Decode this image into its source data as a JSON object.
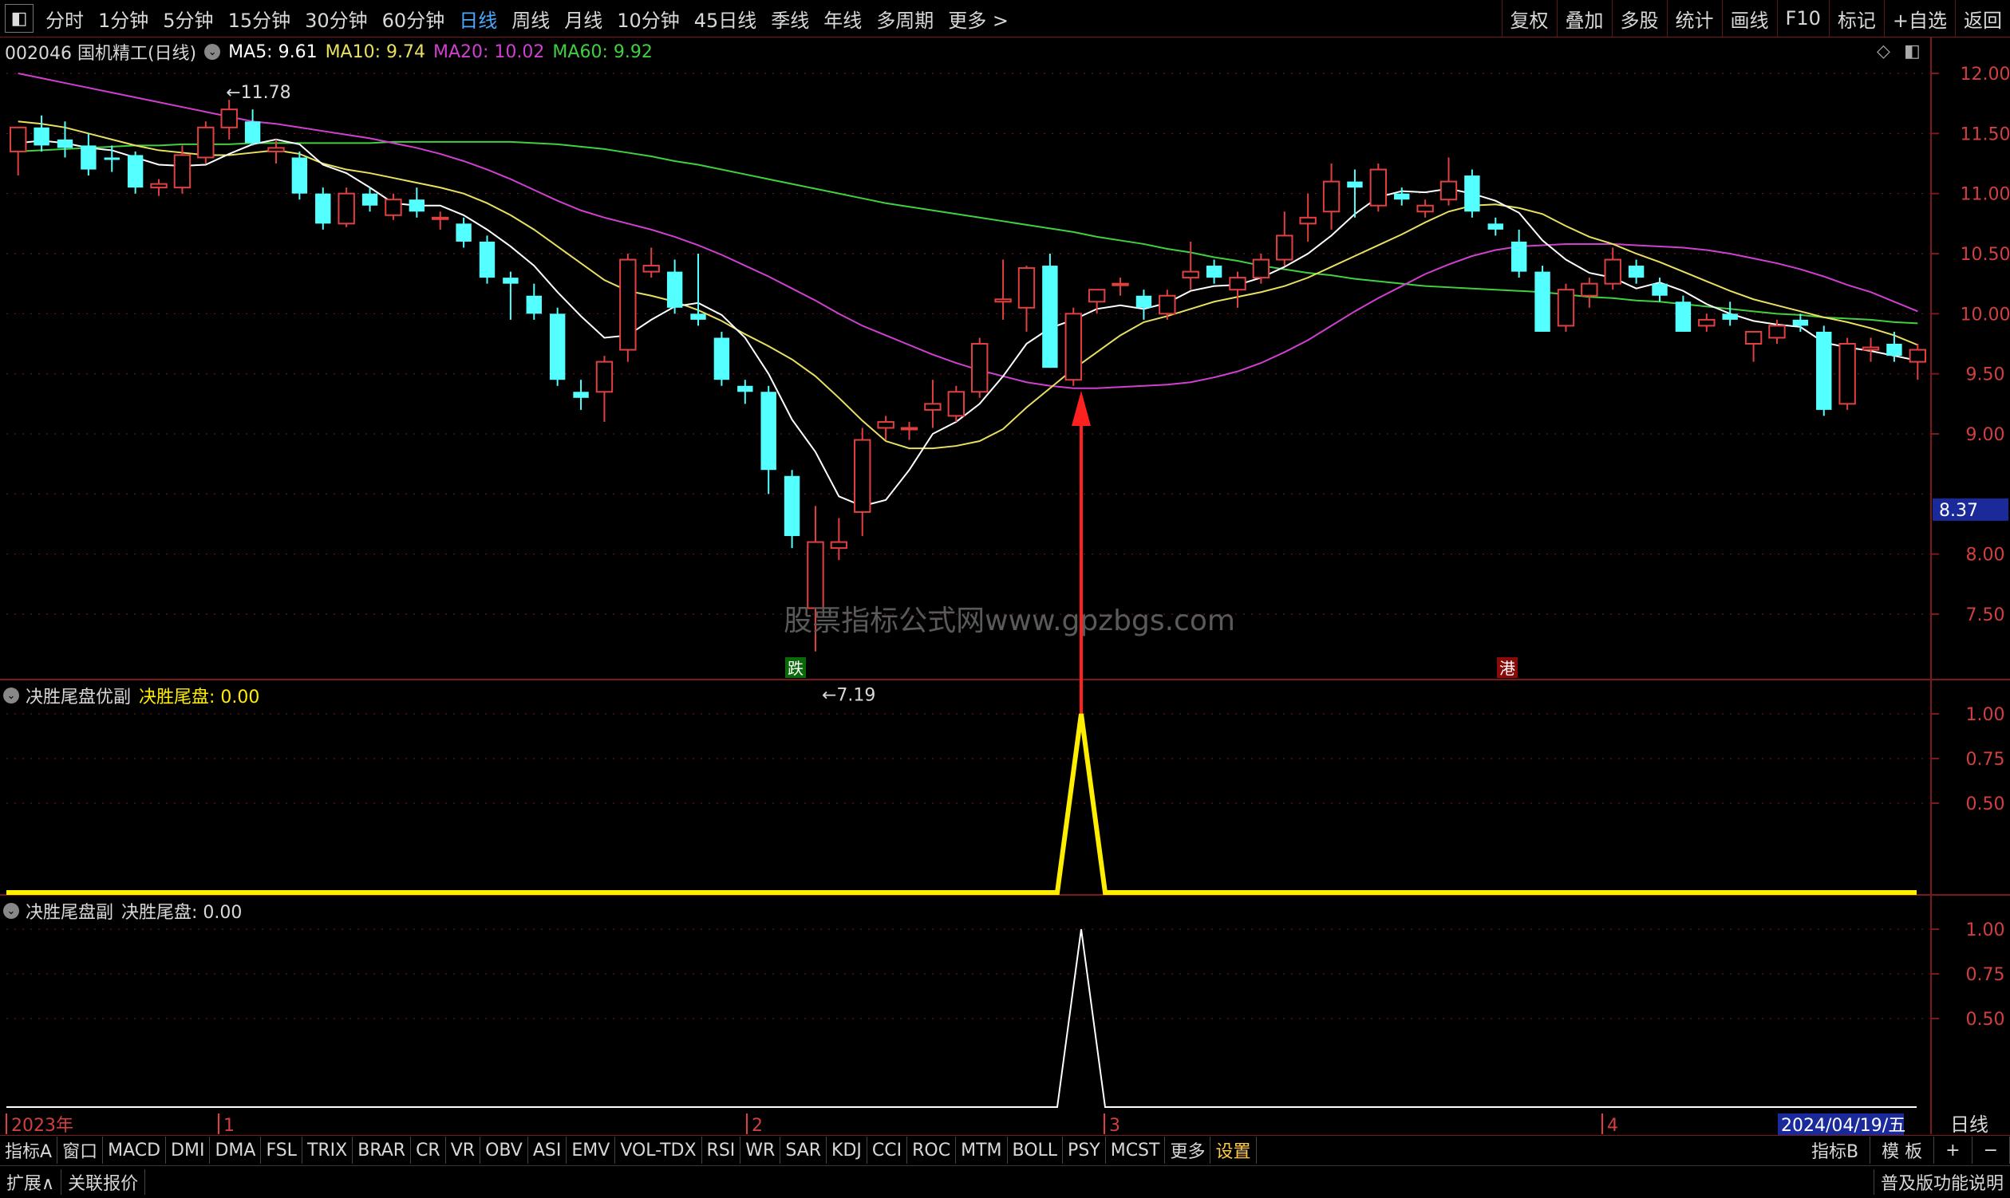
{
  "toolbar": {
    "periods": [
      "分时",
      "1分钟",
      "5分钟",
      "15分钟",
      "30分钟",
      "60分钟",
      "日线",
      "周线",
      "月线",
      "10分钟",
      "45日线",
      "季线",
      "年线",
      "多周期",
      "更多 >"
    ],
    "active_period": "日线",
    "right": [
      "复权",
      "叠加",
      "多股",
      "统计",
      "画线",
      "F10",
      "标记",
      "+自选",
      "返回"
    ]
  },
  "info": {
    "title": "002046 国机精工(日线)",
    "ma5": "MA5: 9.61",
    "ma10": "MA10: 9.74",
    "ma20": "MA20: 10.02",
    "ma60": "MA60: 9.92"
  },
  "colors": {
    "up": "#e04040",
    "down": "#54ffff",
    "ma5": "#ffffff",
    "ma10": "#e8e060",
    "ma20": "#d040d0",
    "ma60": "#40d040",
    "grid": "#7a1a1a",
    "signal": "#ffee00",
    "arrow": "#ff2020"
  },
  "chart_data": [
    {
      "type": "candlestick",
      "title": "002046 国机精工(日线)",
      "ylim": [
        7.0,
        12.2
      ],
      "yticks": [
        "12.00",
        "11.50",
        "11.00",
        "10.50",
        "10.00",
        "9.50",
        "9.00",
        "8.00",
        "7.50"
      ],
      "current_price_label": "8.37",
      "high_label": "11.78",
      "low_label": "7.19",
      "markers": [
        "跌",
        "港"
      ],
      "ohlc": [
        [
          11.35,
          11.55,
          11.15,
          11.55
        ],
        [
          11.55,
          11.65,
          11.35,
          11.4
        ],
        [
          11.45,
          11.6,
          11.3,
          11.38
        ],
        [
          11.4,
          11.5,
          11.15,
          11.2
        ],
        [
          11.3,
          11.4,
          11.18,
          11.28
        ],
        [
          11.32,
          11.35,
          11.0,
          11.05
        ],
        [
          11.05,
          11.12,
          10.98,
          11.08
        ],
        [
          11.05,
          11.4,
          11.0,
          11.32
        ],
        [
          11.3,
          11.6,
          11.25,
          11.55
        ],
        [
          11.55,
          11.78,
          11.45,
          11.7
        ],
        [
          11.6,
          11.7,
          11.4,
          11.42
        ],
        [
          11.35,
          11.45,
          11.25,
          11.38
        ],
        [
          11.3,
          11.35,
          10.95,
          11.0
        ],
        [
          11.0,
          11.05,
          10.7,
          10.75
        ],
        [
          10.75,
          11.05,
          10.72,
          11.0
        ],
        [
          11.0,
          11.05,
          10.85,
          10.9
        ],
        [
          10.82,
          11.0,
          10.78,
          10.95
        ],
        [
          10.95,
          11.05,
          10.8,
          10.85
        ],
        [
          10.8,
          10.85,
          10.7,
          10.8
        ],
        [
          10.75,
          10.8,
          10.55,
          10.6
        ],
        [
          10.6,
          10.65,
          10.25,
          10.3
        ],
        [
          10.3,
          10.35,
          9.95,
          10.25
        ],
        [
          10.15,
          10.25,
          9.95,
          10.0
        ],
        [
          10.0,
          10.05,
          9.4,
          9.45
        ],
        [
          9.35,
          9.45,
          9.2,
          9.3
        ],
        [
          9.35,
          9.65,
          9.1,
          9.6
        ],
        [
          9.7,
          10.5,
          9.6,
          10.45
        ],
        [
          10.35,
          10.55,
          10.3,
          10.4
        ],
        [
          10.35,
          10.45,
          10.0,
          10.05
        ],
        [
          10.0,
          10.5,
          9.9,
          9.95
        ],
        [
          9.8,
          9.85,
          9.4,
          9.45
        ],
        [
          9.4,
          9.45,
          9.25,
          9.35
        ],
        [
          9.35,
          9.4,
          8.5,
          8.7
        ],
        [
          8.65,
          8.7,
          8.05,
          8.15
        ],
        [
          7.55,
          8.4,
          7.19,
          8.1
        ],
        [
          8.05,
          8.3,
          7.95,
          8.1
        ],
        [
          8.35,
          9.05,
          8.15,
          8.95
        ],
        [
          9.05,
          9.15,
          8.95,
          9.1
        ],
        [
          9.05,
          9.1,
          8.95,
          9.05
        ],
        [
          9.2,
          9.45,
          9.05,
          9.25
        ],
        [
          9.15,
          9.4,
          9.1,
          9.35
        ],
        [
          9.35,
          9.8,
          9.3,
          9.75
        ],
        [
          10.1,
          10.45,
          9.95,
          10.12
        ],
        [
          10.05,
          10.4,
          9.85,
          10.38
        ],
        [
          10.4,
          10.5,
          9.55,
          9.55
        ],
        [
          9.45,
          10.05,
          9.4,
          10.0
        ],
        [
          10.1,
          10.2,
          10.0,
          10.2
        ],
        [
          10.25,
          10.3,
          10.15,
          10.25
        ],
        [
          10.15,
          10.2,
          9.95,
          10.05
        ],
        [
          10.0,
          10.2,
          9.95,
          10.15
        ],
        [
          10.3,
          10.6,
          10.2,
          10.35
        ],
        [
          10.4,
          10.45,
          10.25,
          10.3
        ],
        [
          10.2,
          10.35,
          10.05,
          10.3
        ],
        [
          10.3,
          10.5,
          10.25,
          10.45
        ],
        [
          10.45,
          10.85,
          10.4,
          10.65
        ],
        [
          10.75,
          11.0,
          10.6,
          10.8
        ],
        [
          10.85,
          11.25,
          10.7,
          11.1
        ],
        [
          11.1,
          11.2,
          10.8,
          11.05
        ],
        [
          10.9,
          11.25,
          10.85,
          11.2
        ],
        [
          11.0,
          11.05,
          10.9,
          10.95
        ],
        [
          10.85,
          10.95,
          10.8,
          10.9
        ],
        [
          10.95,
          11.3,
          10.9,
          11.1
        ],
        [
          11.15,
          11.2,
          10.8,
          10.85
        ],
        [
          10.75,
          10.8,
          10.65,
          10.7
        ],
        [
          10.6,
          10.7,
          10.3,
          10.35
        ],
        [
          10.35,
          10.4,
          9.85,
          9.85
        ],
        [
          9.9,
          10.25,
          9.85,
          10.2
        ],
        [
          10.15,
          10.3,
          10.05,
          10.25
        ],
        [
          10.25,
          10.55,
          10.2,
          10.45
        ],
        [
          10.4,
          10.45,
          10.25,
          10.3
        ],
        [
          10.25,
          10.3,
          10.1,
          10.15
        ],
        [
          10.1,
          10.15,
          9.85,
          9.85
        ],
        [
          9.9,
          10.0,
          9.85,
          9.95
        ],
        [
          10.0,
          10.1,
          9.9,
          9.95
        ],
        [
          9.75,
          9.85,
          9.6,
          9.85
        ],
        [
          9.8,
          9.95,
          9.75,
          9.9
        ],
        [
          9.95,
          10.0,
          9.85,
          9.9
        ],
        [
          9.85,
          9.9,
          9.15,
          9.2
        ],
        [
          9.25,
          9.8,
          9.2,
          9.75
        ],
        [
          9.7,
          9.8,
          9.6,
          9.72
        ],
        [
          9.75,
          9.85,
          9.6,
          9.65
        ],
        [
          9.6,
          9.75,
          9.45,
          9.7
        ]
      ],
      "ma5": [
        11.42,
        11.44,
        11.42,
        11.38,
        11.36,
        11.3,
        11.24,
        11.23,
        11.24,
        11.33,
        11.41,
        11.45,
        11.41,
        11.24,
        11.17,
        11.05,
        10.92,
        10.9,
        10.9,
        10.82,
        10.7,
        10.56,
        10.4,
        10.18,
        9.98,
        9.8,
        9.82,
        9.95,
        10.06,
        10.09,
        9.99,
        9.8,
        9.5,
        9.12,
        8.85,
        8.48,
        8.4,
        8.45,
        8.7,
        9.0,
        9.1,
        9.25,
        9.48,
        9.75,
        9.88,
        9.95,
        10.04,
        10.07,
        10.04,
        10.09,
        10.19,
        10.23,
        10.24,
        10.3,
        10.39,
        10.5,
        10.65,
        10.83,
        10.97,
        11.02,
        11.01,
        11.04,
        11.0,
        10.94,
        10.84,
        10.61,
        10.45,
        10.34,
        10.3,
        10.21,
        10.26,
        10.19,
        10.08,
        10.0,
        9.94,
        9.91,
        9.89,
        9.76,
        9.72,
        9.69,
        9.65,
        9.61
      ],
      "ma10": [
        11.6,
        11.58,
        11.55,
        11.5,
        11.45,
        11.4,
        11.36,
        11.34,
        11.32,
        11.32,
        11.34,
        11.36,
        11.33,
        11.25,
        11.2,
        11.17,
        11.13,
        11.09,
        11.05,
        11.0,
        10.92,
        10.82,
        10.7,
        10.56,
        10.42,
        10.28,
        10.19,
        10.15,
        10.1,
        10.03,
        9.94,
        9.83,
        9.73,
        9.62,
        9.48,
        9.3,
        9.11,
        8.94,
        8.88,
        8.88,
        8.9,
        8.94,
        9.04,
        9.22,
        9.38,
        9.54,
        9.68,
        9.82,
        9.93,
        9.98,
        10.04,
        10.1,
        10.14,
        10.18,
        10.23,
        10.3,
        10.39,
        10.48,
        10.57,
        10.66,
        10.76,
        10.85,
        10.9,
        10.91,
        10.88,
        10.83,
        10.73,
        10.64,
        10.58,
        10.5,
        10.43,
        10.35,
        10.27,
        10.19,
        10.12,
        10.07,
        10.02,
        9.97,
        9.93,
        9.88,
        9.82,
        9.74
      ],
      "ma20": [
        12.0,
        11.96,
        11.92,
        11.88,
        11.84,
        11.8,
        11.76,
        11.72,
        11.68,
        11.64,
        11.6,
        11.58,
        11.55,
        11.52,
        11.49,
        11.46,
        11.42,
        11.38,
        11.33,
        11.27,
        11.2,
        11.12,
        11.03,
        10.94,
        10.86,
        10.8,
        10.75,
        10.7,
        10.64,
        10.57,
        10.49,
        10.4,
        10.31,
        10.21,
        10.11,
        10.0,
        9.9,
        9.82,
        9.74,
        9.66,
        9.59,
        9.53,
        9.48,
        9.43,
        9.4,
        9.38,
        9.38,
        9.39,
        9.4,
        9.41,
        9.43,
        9.47,
        9.52,
        9.59,
        9.68,
        9.78,
        9.9,
        10.02,
        10.13,
        10.23,
        10.33,
        10.41,
        10.48,
        10.53,
        10.56,
        10.57,
        10.58,
        10.58,
        10.58,
        10.57,
        10.56,
        10.55,
        10.53,
        10.5,
        10.46,
        10.42,
        10.37,
        10.31,
        10.24,
        10.18,
        10.1,
        10.02
      ],
      "ma60": [
        11.35,
        11.36,
        11.37,
        11.38,
        11.39,
        11.4,
        11.4,
        11.41,
        11.41,
        11.41,
        11.42,
        11.42,
        11.42,
        11.42,
        11.42,
        11.42,
        11.43,
        11.43,
        11.43,
        11.43,
        11.43,
        11.43,
        11.42,
        11.41,
        11.39,
        11.37,
        11.34,
        11.31,
        11.27,
        11.24,
        11.2,
        11.16,
        11.12,
        11.08,
        11.04,
        11.0,
        10.96,
        10.92,
        10.89,
        10.86,
        10.83,
        10.8,
        10.77,
        10.74,
        10.71,
        10.68,
        10.64,
        10.61,
        10.58,
        10.54,
        10.51,
        10.47,
        10.44,
        10.4,
        10.37,
        10.34,
        10.32,
        10.29,
        10.27,
        10.25,
        10.23,
        10.22,
        10.21,
        10.2,
        10.19,
        10.18,
        10.16,
        10.14,
        10.13,
        10.11,
        10.1,
        10.08,
        10.06,
        10.04,
        10.02,
        10.0,
        9.99,
        9.97,
        9.96,
        9.95,
        9.93,
        9.92
      ],
      "x_labels": [
        "2023年",
        "1",
        "2",
        "3",
        "4",
        "2024/04/19/五"
      ]
    },
    {
      "type": "line",
      "title": "决胜尾盘优副",
      "series_label": "决胜尾盘: 0.00",
      "ylim": [
        0,
        1.1
      ],
      "yticks": [
        "1.00",
        "0.75",
        "0.50"
      ],
      "signal_index": 44,
      "values_note": "0 everywhere except 1.00 at the signal day"
    },
    {
      "type": "line",
      "title": "决胜尾盘副",
      "series_label": "决胜尾盘: 0.00",
      "ylim": [
        0,
        1.1
      ],
      "yticks": [
        "1.00",
        "0.75",
        "0.50"
      ],
      "signal_index": 44
    }
  ],
  "panes": {
    "p1_title": "决胜尾盘优副",
    "p1_value": "决胜尾盘: 0.00",
    "p2_title": "决胜尾盘副",
    "p2_value": "决胜尾盘: 0.00"
  },
  "watermark": "股票指标公式网www.gpzbgs.com",
  "bottom_tabs": [
    "指标A",
    "窗口",
    "MACD",
    "DMI",
    "DMA",
    "FSL",
    "TRIX",
    "BRAR",
    "CR",
    "VR",
    "OBV",
    "ASI",
    "EMV",
    "VOL-TDX",
    "RSI",
    "WR",
    "SAR",
    "KDJ",
    "CCI",
    "ROC",
    "MTM",
    "BOLL",
    "PSY",
    "MCST",
    "更多",
    "设置"
  ],
  "bottom_right": [
    "指标B",
    "模 板",
    "+",
    "−"
  ],
  "period_box": "日线",
  "status": [
    "扩展∧",
    "关联报价"
  ],
  "status_right": "普及版功能说明"
}
